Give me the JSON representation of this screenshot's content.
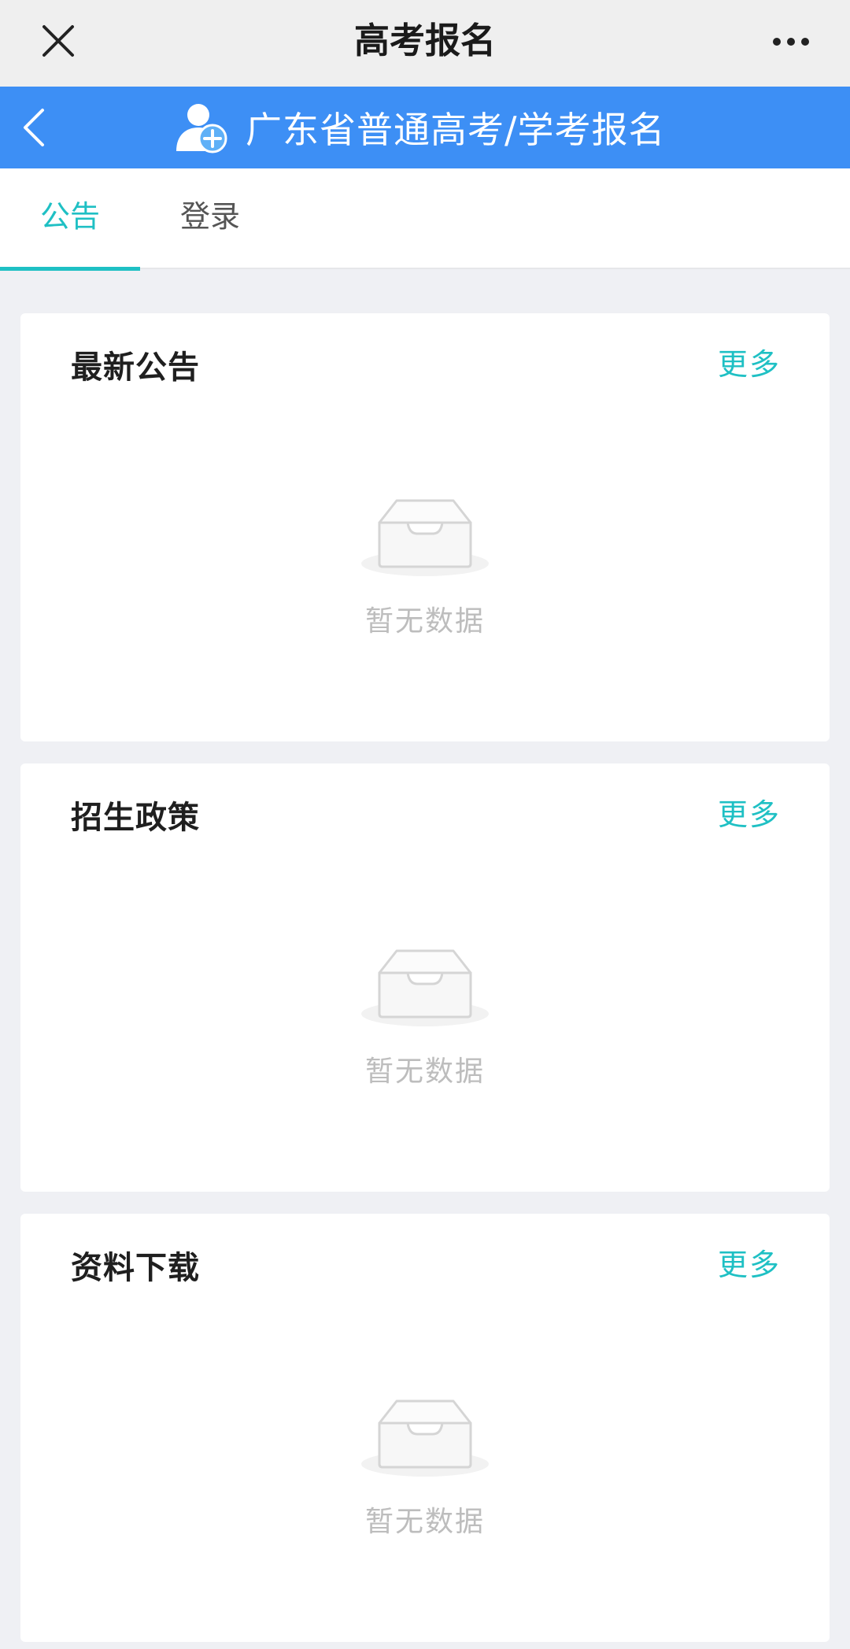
{
  "window": {
    "title": "高考报名"
  },
  "header": {
    "title": "广东省普通高考/学考报名"
  },
  "tabs": [
    {
      "label": "公告",
      "active": true
    },
    {
      "label": "登录",
      "active": false
    }
  ],
  "sections": [
    {
      "title": "最新公告",
      "more_label": "更多",
      "empty_text": "暂无数据"
    },
    {
      "title": "招生政策",
      "more_label": "更多",
      "empty_text": "暂无数据"
    },
    {
      "title": "资料下载",
      "more_label": "更多",
      "empty_text": "暂无数据"
    }
  ],
  "colors": {
    "header_bg": "#3d8ff5",
    "accent": "#1fc0c4",
    "page_bg": "#eff0f4"
  },
  "icons": {
    "close": "close-icon",
    "more": "more-dots-icon",
    "back": "chevron-left-icon",
    "user_add": "user-add-icon",
    "empty": "empty-inbox-icon"
  }
}
